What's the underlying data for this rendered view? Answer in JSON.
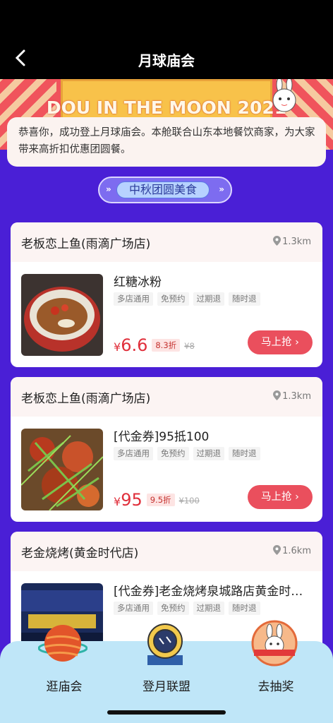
{
  "nav": {
    "title": "月球庙会",
    "back_icon": "back-chevron-icon"
  },
  "banner": {
    "text": "DOU IN THE MOON 2021"
  },
  "intro": {
    "text": "恭喜你，成功登上月球庙会。本舱联合山东本地餐饮商家，为大家带来高折扣优惠团圆餐。"
  },
  "section": {
    "title": "中秋团圆美食",
    "arrow_left": "»",
    "arrow_right": "»"
  },
  "cards": [
    {
      "store": "老板恋上鱼(雨滴广场店)",
      "distance": "1.3km",
      "title": "红糖冰粉",
      "tags": [
        "多店通用",
        "免预约",
        "过期退",
        "随时退"
      ],
      "yen": "¥",
      "price": "6.6",
      "discount": "8.3折",
      "original": "¥8",
      "button": "马上抢 ›"
    },
    {
      "store": "老板恋上鱼(雨滴广场店)",
      "distance": "1.3km",
      "title": "[代金券]95抵100",
      "tags": [
        "多店通用",
        "免预约",
        "过期退",
        "随时退"
      ],
      "yen": "¥",
      "price": "95",
      "discount": "9.5折",
      "original": "¥100",
      "button": "马上抢 ›"
    },
    {
      "store": "老金烧烤(黄金时代店)",
      "distance": "1.6km",
      "title": "[代金券]老金烧烤泉城路店黄金时…",
      "tags": [
        "多店通用",
        "免预约",
        "过期退",
        "随时退"
      ]
    }
  ],
  "tabs": [
    {
      "label": "逛庙会",
      "icon": "planet-icon"
    },
    {
      "label": "登月联盟",
      "icon": "astronaut-icon"
    },
    {
      "label": "去抽奖",
      "icon": "rabbit-lottery-icon"
    }
  ],
  "colors": {
    "accent": "#ea4f5d",
    "background": "#4a1fd6",
    "price": "#e02f3b"
  }
}
